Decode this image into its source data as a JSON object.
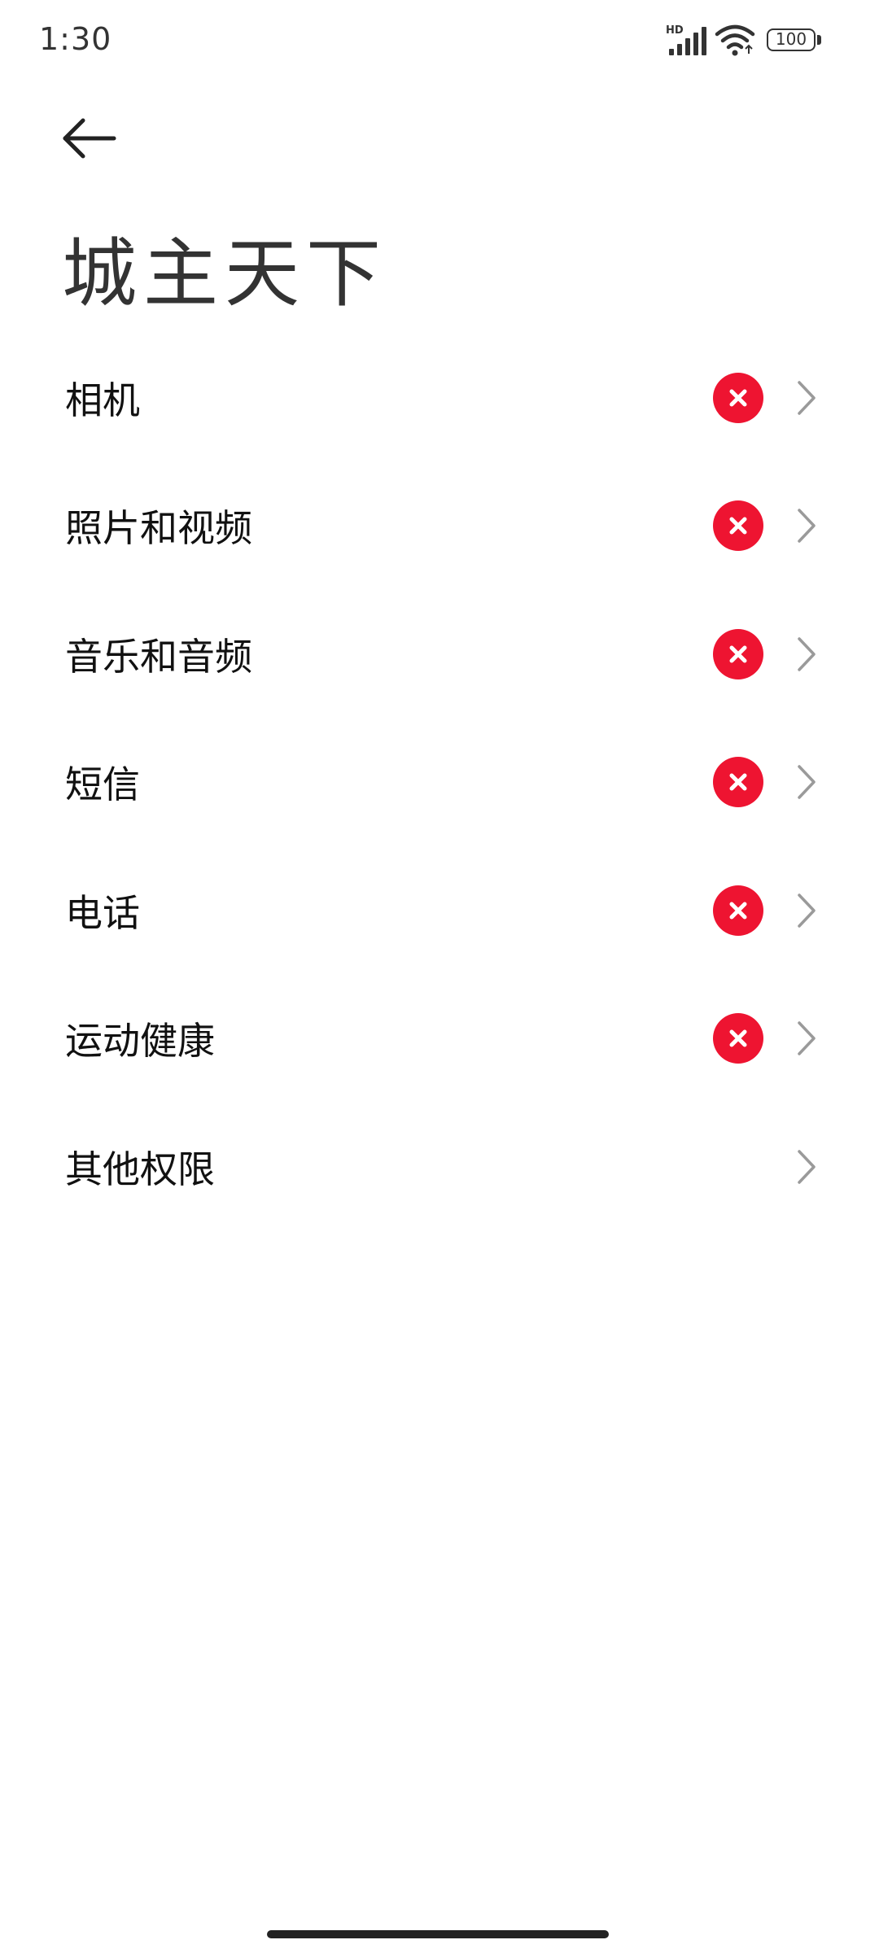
{
  "status_bar": {
    "time": "1:30",
    "network_badge": "HD",
    "battery_level": "100",
    "icons": [
      "signal-icon",
      "wifi-icon",
      "battery-icon"
    ]
  },
  "header": {
    "back_icon": "arrow-left-icon",
    "title": "城主天下"
  },
  "permissions": [
    {
      "label": "相机",
      "denied": true
    },
    {
      "label": "照片和视频",
      "denied": true
    },
    {
      "label": "音乐和音频",
      "denied": true
    },
    {
      "label": "短信",
      "denied": true
    },
    {
      "label": "电话",
      "denied": true
    },
    {
      "label": "运动健康",
      "denied": true
    },
    {
      "label": "其他权限",
      "denied": false
    }
  ],
  "colors": {
    "deny_badge": "#ee1431",
    "chevron": "#9a9a9a",
    "text": "#111111",
    "background": "#ffffff"
  }
}
